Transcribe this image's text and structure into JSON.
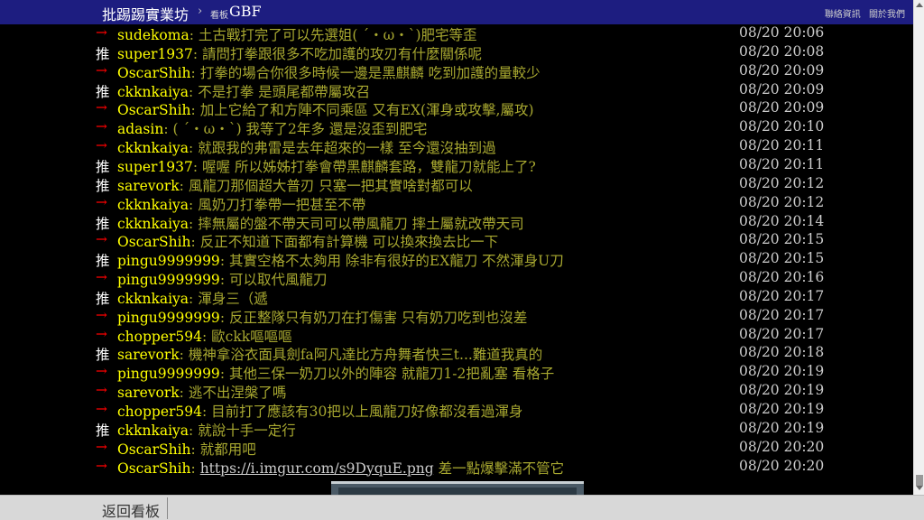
{
  "header": {
    "site_title": "批踢踢實業坊",
    "separator": "›",
    "board_prefix": "看板",
    "board_name": "GBF",
    "links": [
      "聯絡資訊",
      "關於我們"
    ]
  },
  "comments": [
    {
      "tag": "→",
      "type": "arrow",
      "user": "sudekoma",
      "text": ": 土古戰打完了可以先選姐( ´・ω・`)肥宅等歪",
      "time": "08/20 20:06"
    },
    {
      "tag": "推",
      "type": "push",
      "user": "super1937",
      "text": ": 請問打拳跟很多不吃加護的攻刃有什麼關係呢",
      "time": "08/20 20:08"
    },
    {
      "tag": "→",
      "type": "arrow",
      "user": "OscarShih",
      "text": ": 打拳的場合你很多時候一邊是黑麒麟 吃到加護的量較少",
      "time": "08/20 20:09"
    },
    {
      "tag": "推",
      "type": "push",
      "user": "ckknkaiya",
      "text": ": 不是打拳 是頭尾都帶屬攻召",
      "time": "08/20 20:09"
    },
    {
      "tag": "→",
      "type": "arrow",
      "user": "OscarShih",
      "text": ": 加上它給了和方陣不同乘區 又有EX(渾身或攻擊,屬攻)",
      "time": "08/20 20:09"
    },
    {
      "tag": "→",
      "type": "arrow",
      "user": "adasin",
      "text": ": ( ´・ω・`) 我等了2年多 還是沒歪到肥宅",
      "time": "08/20 20:10"
    },
    {
      "tag": "→",
      "type": "arrow",
      "user": "ckknkaiya",
      "text": ": 就跟我的弗雷是去年超來的一樣 至今還沒抽到過",
      "time": "08/20 20:11"
    },
    {
      "tag": "推",
      "type": "push",
      "user": "super1937",
      "text": ": 喔喔 所以姊姊打拳會帶黑麒麟套路，雙龍刀就能上了?",
      "time": "08/20 20:11"
    },
    {
      "tag": "推",
      "type": "push",
      "user": "sarevork",
      "text": ": 風龍刀那個超大普刃 只塞一把其實啥對都可以",
      "time": "08/20 20:12"
    },
    {
      "tag": "→",
      "type": "arrow",
      "user": "ckknkaiya",
      "text": ": 風奶刀打拳帶一把甚至不帶",
      "time": "08/20 20:12"
    },
    {
      "tag": "推",
      "type": "push",
      "user": "ckknkaiya",
      "text": ": 摔無屬的盤不帶天司可以帶風龍刀 摔土屬就改帶天司",
      "time": "08/20 20:14"
    },
    {
      "tag": "→",
      "type": "arrow",
      "user": "OscarShih",
      "text": ": 反正不知道下面都有計算機 可以換來換去比一下",
      "time": "08/20 20:15"
    },
    {
      "tag": "推",
      "type": "push",
      "user": "pingu9999999",
      "text": ": 其實空格不太夠用 除非有很好的EX龍刀 不然渾身U刀",
      "time": "08/20 20:15"
    },
    {
      "tag": "→",
      "type": "arrow",
      "user": "pingu9999999",
      "text": ": 可以取代風龍刀",
      "time": "08/20 20:16"
    },
    {
      "tag": "推",
      "type": "push",
      "user": "ckknkaiya",
      "text": ": 渾身三（遞",
      "time": "08/20 20:17"
    },
    {
      "tag": "→",
      "type": "arrow",
      "user": "pingu9999999",
      "text": ": 反正整隊只有奶刀在打傷害 只有奶刀吃到也沒差",
      "time": "08/20 20:17"
    },
    {
      "tag": "→",
      "type": "arrow",
      "user": "chopper594",
      "text": ": 歐ckk嘔嘔嘔",
      "time": "08/20 20:17"
    },
    {
      "tag": "推",
      "type": "push",
      "user": "sarevork",
      "text": ": 機神拿浴衣面具劍fa阿凡達比方舟舞者快三t...難道我真的",
      "time": "08/20 20:18"
    },
    {
      "tag": "→",
      "type": "arrow",
      "user": "pingu9999999",
      "text": ": 其他三保一奶刀以外的陣容 就龍刀1-2把亂塞 看格子",
      "time": "08/20 20:19"
    },
    {
      "tag": "→",
      "type": "arrow",
      "user": "sarevork",
      "text": ": 逃不出涅槃了嗎",
      "time": "08/20 20:19"
    },
    {
      "tag": "→",
      "type": "arrow",
      "user": "chopper594",
      "text": ": 目前打了應該有30把以上風龍刀好像都沒看過渾身",
      "time": "08/20 20:19"
    },
    {
      "tag": "推",
      "type": "push",
      "user": "ckknkaiya",
      "text": ": 就說十手一定行",
      "time": "08/20 20:19"
    },
    {
      "tag": "→",
      "type": "arrow",
      "user": "OscarShih",
      "text": ": 就都用吧",
      "time": "08/20 20:20"
    },
    {
      "tag": "→",
      "type": "arrow",
      "user": "OscarShih",
      "text": ": ",
      "link": "https://i.imgur.com/s9DyquE.png",
      "after": " 差一點爆擊滿不管它",
      "time": "08/20 20:20"
    }
  ],
  "footer": {
    "back_label": "返回看板"
  },
  "colors": {
    "header_bg": "#1d1d80",
    "user": "#ffff00",
    "comment_text": "#a8a830",
    "push_tag": "#ffffff",
    "arrow_tag": "#ff0000",
    "time": "#cccccc"
  }
}
